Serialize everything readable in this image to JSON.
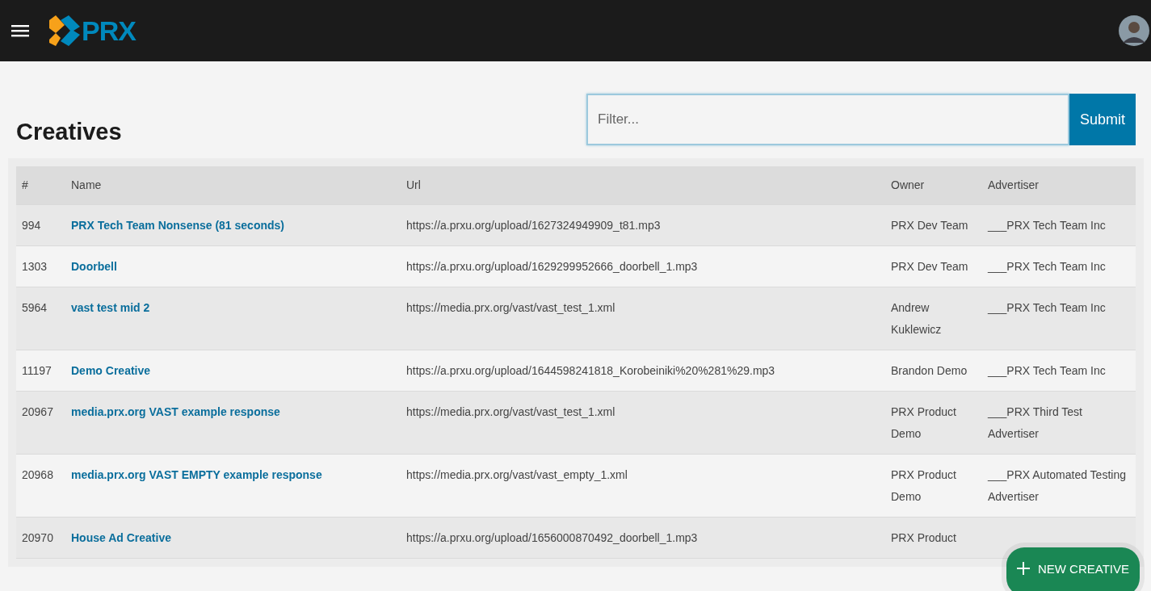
{
  "header": {
    "logo_text": "PRX"
  },
  "page": {
    "title": "Creatives"
  },
  "filter": {
    "placeholder": "Filter...",
    "submit": "Submit"
  },
  "table": {
    "columns": [
      "#",
      "Name",
      "Url",
      "Owner",
      "Advertiser"
    ],
    "rows": [
      {
        "id": "994",
        "name": "PRX Tech Team Nonsense (81 seconds)",
        "url": "https://a.prxu.org/upload/1627324949909_t81.mp3",
        "owner": "PRX Dev Team",
        "advertiser": "___PRX Tech Team Inc"
      },
      {
        "id": "1303",
        "name": "Doorbell",
        "url": "https://a.prxu.org/upload/1629299952666_doorbell_1.mp3",
        "owner": "PRX Dev Team",
        "advertiser": "___PRX Tech Team Inc"
      },
      {
        "id": "5964",
        "name": "vast test mid 2",
        "url": "https://media.prx.org/vast/vast_test_1.xml",
        "owner": "Andrew Kuklewicz",
        "advertiser": "___PRX Tech Team Inc"
      },
      {
        "id": "11197",
        "name": "Demo Creative",
        "url": "https://a.prxu.org/upload/1644598241818_Korobeiniki%20%281%29.mp3",
        "owner": "Brandon Demo",
        "advertiser": "___PRX Tech Team Inc"
      },
      {
        "id": "20967",
        "name": "media.prx.org VAST example response",
        "url": "https://media.prx.org/vast/vast_test_1.xml",
        "owner": "PRX Product Demo",
        "advertiser": "___PRX Third Test Advertiser"
      },
      {
        "id": "20968",
        "name": "media.prx.org VAST EMPTY example response",
        "url": "https://media.prx.org/vast/vast_empty_1.xml",
        "owner": "PRX Product Demo",
        "advertiser": "___PRX Automated Testing Advertiser"
      },
      {
        "id": "20970",
        "name": "House Ad Creative",
        "url": "https://a.prxu.org/upload/1656000870492_doorbell_1.mp3",
        "owner": "PRX Product"
      }
    ]
  },
  "fab": {
    "label": "NEW CREATIVE"
  }
}
